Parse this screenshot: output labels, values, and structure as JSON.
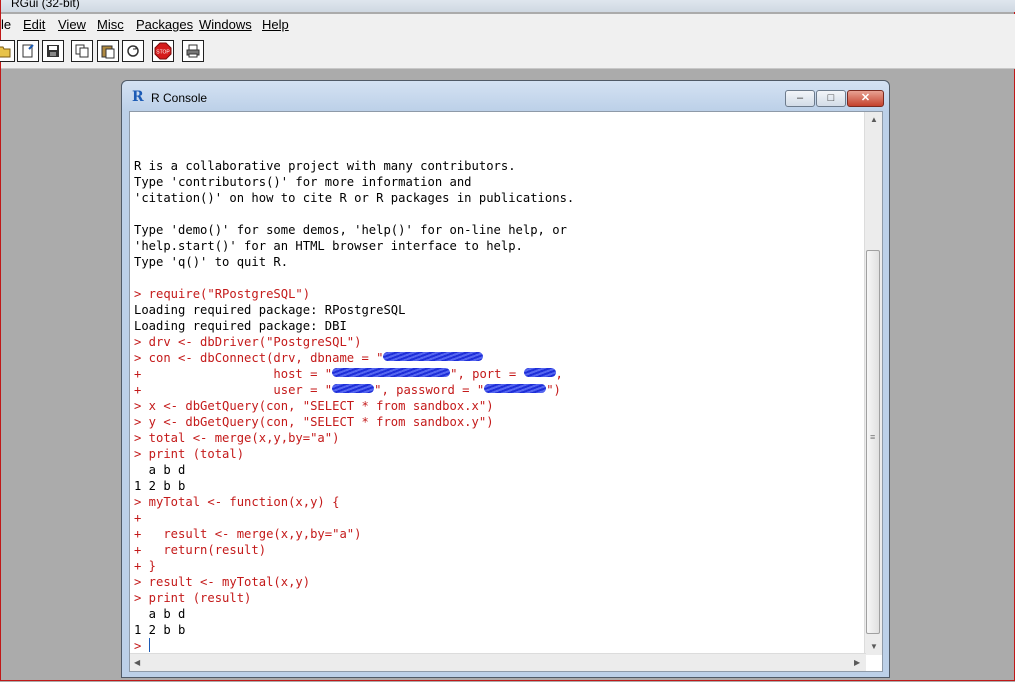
{
  "app": {
    "title": "RGui (32-bit)"
  },
  "menu": {
    "items": [
      {
        "label": "le"
      },
      {
        "label": "Edit"
      },
      {
        "label": "View"
      },
      {
        "label": "Misc"
      },
      {
        "label": "Packages"
      },
      {
        "label": "Windows"
      },
      {
        "label": "Help"
      }
    ]
  },
  "toolbar": {
    "buttons": [
      {
        "icon": "open-script-icon"
      },
      {
        "icon": "load-workspace-icon"
      },
      {
        "icon": "save-icon"
      },
      {
        "icon": "copy-icon"
      },
      {
        "icon": "paste-icon"
      },
      {
        "icon": "copy-paste-icon"
      },
      {
        "icon": "stop-icon",
        "label": "STOP"
      },
      {
        "icon": "print-icon"
      }
    ]
  },
  "console": {
    "title": "R Console",
    "lines": [
      {
        "t": "out",
        "text": ""
      },
      {
        "t": "out",
        "text": "R is a collaborative project with many contributors."
      },
      {
        "t": "out",
        "text": "Type 'contributors()' for more information and"
      },
      {
        "t": "out",
        "text": "'citation()' on how to cite R or R packages in publications."
      },
      {
        "t": "out",
        "text": ""
      },
      {
        "t": "out",
        "text": "Type 'demo()' for some demos, 'help()' for on-line help, or"
      },
      {
        "t": "out",
        "text": "'help.start()' for an HTML browser interface to help."
      },
      {
        "t": "out",
        "text": "Type 'q()' to quit R."
      },
      {
        "t": "out",
        "text": ""
      },
      {
        "t": "in",
        "text": "> require(\"RPostgreSQL\")"
      },
      {
        "t": "out",
        "text": "Loading required package: RPostgreSQL"
      },
      {
        "t": "out",
        "text": "Loading required package: DBI"
      },
      {
        "t": "in",
        "text": "> drv <- dbDriver(\"PostgreSQL\")"
      },
      {
        "t": "in",
        "text": "> con <- dbConnect(drv, dbname = \"",
        "redact": [
          100
        ]
      },
      {
        "t": "in",
        "text": "+                  host = \"",
        "redact": [
          118
        ],
        "text2": "\", port = ",
        "redact2": [
          32
        ],
        "text3": ","
      },
      {
        "t": "in",
        "text": "+                  user = \"",
        "redact": [
          42
        ],
        "text2": "\", password = \"",
        "redact2": [
          62
        ],
        "text3": "\")"
      },
      {
        "t": "in",
        "text": "> x <- dbGetQuery(con, \"SELECT * from sandbox.x\")"
      },
      {
        "t": "in",
        "text": "> y <- dbGetQuery(con, \"SELECT * from sandbox.y\")"
      },
      {
        "t": "in",
        "text": "> total <- merge(x,y,by=\"a\")"
      },
      {
        "t": "in",
        "text": "> print (total)"
      },
      {
        "t": "out",
        "text": "  a b d"
      },
      {
        "t": "out",
        "text": "1 2 b b"
      },
      {
        "t": "in",
        "text": "> myTotal <- function(x,y) {"
      },
      {
        "t": "in",
        "text": "+"
      },
      {
        "t": "in",
        "text": "+   result <- merge(x,y,by=\"a\")"
      },
      {
        "t": "in",
        "text": "+   return(result)"
      },
      {
        "t": "in",
        "text": "+ }"
      },
      {
        "t": "in",
        "text": "> result <- myTotal(x,y)"
      },
      {
        "t": "in",
        "text": "> print (result)"
      },
      {
        "t": "out",
        "text": "  a b d"
      },
      {
        "t": "out",
        "text": "1 2 b b"
      },
      {
        "t": "in",
        "text": "> ",
        "cursor": true
      }
    ]
  }
}
